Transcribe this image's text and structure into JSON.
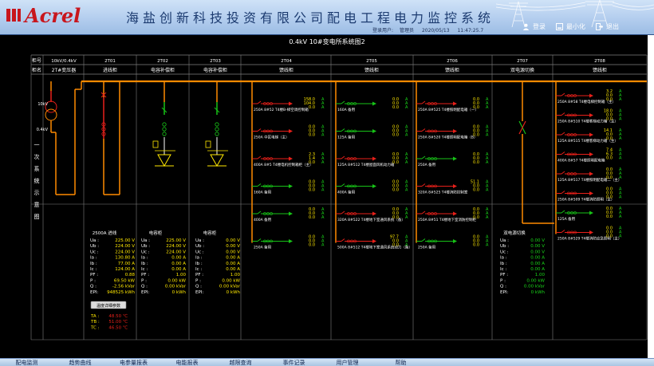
{
  "header": {
    "brand": "Acrel",
    "title": "海盐创新科技投资有限公司配电工程电力监控系统",
    "login_user_label": "登录用户:",
    "login_user": "管理员",
    "date": "2020/05/13",
    "time": "11:47:25.7",
    "buttons": [
      {
        "label": "登录",
        "icon": "user-icon"
      },
      {
        "label": "最小化",
        "icon": "minimize-icon"
      },
      {
        "label": "退出",
        "icon": "exit-icon"
      }
    ]
  },
  "page_title": "0.4kV 10#变电所系统图2",
  "colors": {
    "bus": "#ff8a00",
    "busbar_line": "#ffb000",
    "closed": "#e8201a",
    "open": "#17c317",
    "value_yellow": "#ffe800",
    "value_green": "#19d619",
    "label_white": "#ffffff",
    "grid": "#7f7f7f"
  },
  "table": {
    "row1_label": "柜号",
    "row2_label": "柜名",
    "col1_top": "10kV/0.4kV",
    "col1_name": "2T#变压器",
    "columns": [
      {
        "no": "2T01",
        "name": "进线柜"
      },
      {
        "no": "2T02",
        "name": "电容补偿柜"
      },
      {
        "no": "2T03",
        "name": "电容补偿柜"
      },
      {
        "no": "2T04",
        "name": "馈线柜"
      },
      {
        "no": "2T05",
        "name": "馈线柜"
      },
      {
        "no": "2T06",
        "name": "馈线柜"
      },
      {
        "no": "2T07",
        "name": "双电源切换"
      },
      {
        "no": "2T08",
        "name": "馈线柜"
      }
    ]
  },
  "side_label": [
    "一",
    "次",
    "系",
    "统",
    "示",
    "意",
    "图"
  ],
  "transformer": {
    "hv": "10kV",
    "lv": "0.4kV"
  },
  "incoming": {
    "title": "2500A 进线",
    "rows": [
      [
        "Ua :",
        "225.00 V"
      ],
      [
        "Ub :",
        "224.00 V"
      ],
      [
        "Uc :",
        "224.00 V"
      ],
      [
        "Ia :",
        "130.80 A"
      ],
      [
        "Ib :",
        "77.00 A"
      ],
      [
        "Ic :",
        "124.00 A"
      ],
      [
        "PF :",
        "0.88"
      ],
      [
        "P :",
        "69.50 kW"
      ],
      [
        "Q :",
        "-2.56 kVar"
      ],
      [
        "EPI:",
        "948525 kWh"
      ]
    ],
    "button": "温度详细参数",
    "temps": [
      [
        "TA :",
        "48.50 ℃"
      ],
      [
        "TB :",
        "51.00 ℃"
      ],
      [
        "TC :",
        "46.50 ℃"
      ]
    ]
  },
  "capacitor1": {
    "title": "电容柜",
    "rows": [
      [
        "Ua :",
        "225.00 V"
      ],
      [
        "Ub :",
        "224.00 V"
      ],
      [
        "Uc :",
        "224.00 V"
      ],
      [
        "Ia :",
        "0.00 A"
      ],
      [
        "Ib :",
        "0.00 A"
      ],
      [
        "Ic :",
        "0.00 A"
      ],
      [
        "PF :",
        "1.00"
      ],
      [
        "P :",
        "0.00 kW"
      ],
      [
        "Q :",
        "0.00 kVar"
      ],
      [
        "EPI:",
        "0 kWh"
      ]
    ]
  },
  "capacitor2": {
    "title": "电容柜",
    "rows": [
      [
        "Ua :",
        "0.00 V"
      ],
      [
        "Ub :",
        "0.00 V"
      ],
      [
        "Uc :",
        "0.00 V"
      ],
      [
        "Ia :",
        "0.00 A"
      ],
      [
        "Ib :",
        "0.00 A"
      ],
      [
        "Ic :",
        "0.00 A"
      ],
      [
        "PF :",
        "1.00"
      ],
      [
        "P :",
        "0.00 kW"
      ],
      [
        "Q :",
        "0.00 kVar"
      ],
      [
        "EPI:",
        "0 kWh"
      ]
    ]
  },
  "dual_power": {
    "title": "双电源切换",
    "rows": [
      [
        "Ua :",
        "0.00 V"
      ],
      [
        "Ub :",
        "0.00 V"
      ],
      [
        "Uc :",
        "0.00 V"
      ],
      [
        "Ia :",
        "0.00 A"
      ],
      [
        "Ib :",
        "0.00 A"
      ],
      [
        "Ic :",
        "0.00 A"
      ],
      [
        "PF :",
        "1.00"
      ],
      [
        "P :",
        "0.00 kW"
      ],
      [
        "Q :",
        "0.00 kVar"
      ],
      [
        "EPI:",
        "0 kWh"
      ]
    ]
  },
  "feeders": {
    "col4": [
      {
        "label": "250A 8#52 T4楼B-梯空调控制箱",
        "on": true,
        "v": [
          "158.0",
          "104.0",
          "0.0"
        ]
      },
      {
        "label": "250A 中区电梯（主）",
        "on": true,
        "v": [
          "0.0",
          "0.0",
          "0.0"
        ]
      },
      {
        "label": "400A 8#5 T4楼电机控制箱柜（主）",
        "on": true,
        "v": [
          "2.3",
          "1.4",
          "0.0"
        ]
      },
      {
        "label": "160A 备用",
        "on": false,
        "v": [
          "0.0",
          "0.0",
          "0.0"
        ]
      },
      {
        "label": "400A 备用",
        "on": false,
        "v": [
          "0.0",
          "0.0",
          "0.0"
        ]
      },
      {
        "label": "250A 备用",
        "on": false,
        "v": [
          "0.0",
          "0.0",
          "0.0"
        ]
      }
    ],
    "col5": [
      {
        "label": "160A 备用",
        "on": false,
        "v": [
          "0.0",
          "0.0",
          "0.0"
        ]
      },
      {
        "label": "125A 备用",
        "on": false,
        "v": [
          "0.0",
          "0.0",
          "0.0"
        ]
      },
      {
        "label": "125A 8#512 T4楼屋面风机动力箱",
        "on": true,
        "v": [
          "0.0",
          "0.0",
          "0.0"
        ]
      },
      {
        "label": "400A 备用",
        "on": false,
        "v": [
          "0.0",
          "0.0",
          "0.0"
        ]
      },
      {
        "label": "320A 8#522 T4楼地下室通风系统（备）",
        "on": true,
        "v": [
          "0.0",
          "0.0",
          "0.0"
        ]
      },
      {
        "label": "500A 8#512 T4楼地下室通风系统动力（备）",
        "on": true,
        "v": [
          "97.7",
          "0.0",
          "0.0"
        ]
      }
    ],
    "col6": [
      {
        "label": "250A 8#525 T4楼照明配电箱（一）",
        "on": true,
        "v": [
          "0.0",
          "0.0",
          "0.0"
        ]
      },
      {
        "label": "250A 8#520 T4楼照明配电箱（B）",
        "on": true,
        "v": [
          "0.0",
          "0.0",
          "0.0"
        ]
      },
      {
        "label": "250A 备用",
        "on": false,
        "v": [
          "0.0",
          "0.0",
          "0.0"
        ]
      },
      {
        "label": "320A 8#525 T4楼消防控制室",
        "on": true,
        "v": [
          "51.1",
          "0.0",
          "0.0"
        ]
      },
      {
        "label": "250A 8#51 T4楼地下室消防控制柜",
        "on": true,
        "v": [
          "0.0",
          "0.0",
          "0.0"
        ]
      },
      {
        "label": "250A 备用",
        "on": false,
        "v": [
          "0.0",
          "0.0",
          "0.0"
        ]
      }
    ],
    "col8": [
      {
        "label": "250A 8#58 T4楼电梯控制箱（主）",
        "on": true,
        "v": [
          "3.2",
          "0.0",
          "0.0"
        ]
      },
      {
        "label": "250A 8#510 T4楼客梯动力箱（主）",
        "on": true,
        "v": [
          "18.0",
          "0.0",
          "0.0"
        ]
      },
      {
        "label": "125A 8#515 T4楼客梯动力箱（主）",
        "on": true,
        "v": [
          "14.1",
          "0.0",
          "0.0"
        ]
      },
      {
        "label": "400A 8#57 T4楼照明配电箱",
        "on": true,
        "v": [
          "7.4",
          "6.3",
          "0.0"
        ]
      },
      {
        "label": "125A 8#517 T4楼照明配电箱二（主）",
        "on": true,
        "v": [
          "0.0",
          "0.0",
          "0.0"
        ]
      },
      {
        "label": "250A 8#509 T4楼消防照明（主）",
        "on": true,
        "v": [
          "0.0",
          "0.0",
          "0.0"
        ]
      },
      {
        "label": "125A 备用",
        "on": false,
        "v": [
          "0.0",
          "0.0",
          "0.0"
        ]
      },
      {
        "label": "250A 8#529 T4楼消防应急照明（主）",
        "on": true,
        "v": [
          "0.0",
          "0.0",
          "0.0"
        ]
      }
    ]
  },
  "nav": [
    "配电监测",
    "趋势曲线",
    "电参量报表",
    "电能报表",
    "越限查询",
    "事件记录",
    "用户管理",
    "帮助"
  ],
  "units": {
    "a": "A"
  }
}
